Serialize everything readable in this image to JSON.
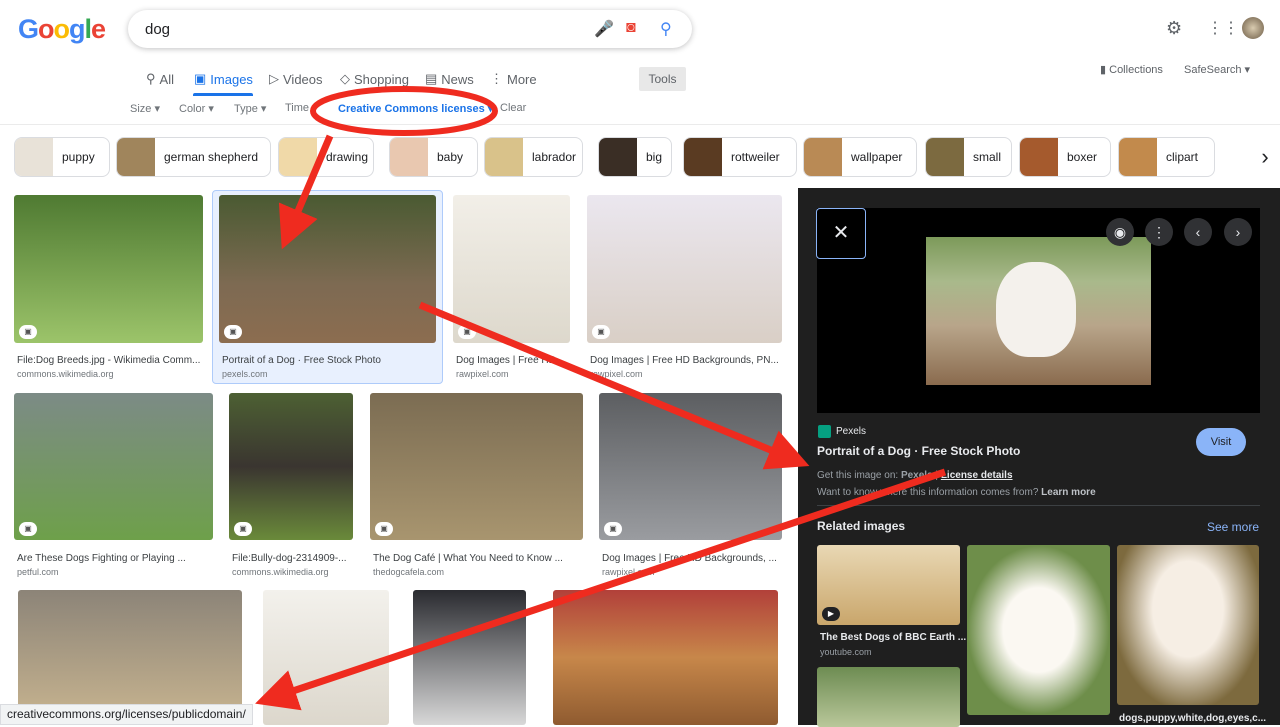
{
  "header": {
    "logo": "Google",
    "query": "dog",
    "settings_icon": "gear-icon",
    "apps_icon": "grid-icon"
  },
  "tabs": [
    {
      "label": "All",
      "icon": "search-icon"
    },
    {
      "label": "Images",
      "icon": "image-icon",
      "active": true
    },
    {
      "label": "Videos",
      "icon": "play-icon"
    },
    {
      "label": "Shopping",
      "icon": "tag-icon"
    },
    {
      "label": "News",
      "icon": "news-icon"
    },
    {
      "label": "More",
      "icon": "dots-icon"
    }
  ],
  "tools_label": "Tools",
  "filters": {
    "size": "Size",
    "color": "Color",
    "type": "Type",
    "time": "Time",
    "license": "Creative Commons licenses",
    "clear": "Clear"
  },
  "right_links": {
    "collections": "Collections",
    "safesearch": "SafeSearch"
  },
  "chips": [
    "puppy",
    "german shepherd",
    "drawing",
    "baby",
    "labrador",
    "big",
    "rottweiler",
    "wallpaper",
    "small",
    "boxer",
    "clipart"
  ],
  "results": [
    {
      "title": "File:Dog Breeds.jpg - Wikimedia Comm...",
      "source": "commons.wikimedia.org"
    },
    {
      "title": "Portrait of a Dog · Free Stock Photo",
      "source": "pexels.com"
    },
    {
      "title": "Dog Images | Free HD ...",
      "source": "rawpixel.com"
    },
    {
      "title": "Dog Images | Free HD Backgrounds, PN...",
      "source": "rawpixel.com"
    },
    {
      "title": "Are These Dogs Fighting or Playing ...",
      "source": "petful.com"
    },
    {
      "title": "File:Bully-dog-2314909-...",
      "source": "commons.wikimedia.org"
    },
    {
      "title": "The Dog Café | What You Need to Know ...",
      "source": "thedogcafela.com"
    },
    {
      "title": "Dog Images | Free HD Backgrounds, ...",
      "source": "rawpixel.com"
    }
  ],
  "panel": {
    "source": "Pexels",
    "title": "Portrait of a Dog · Free Stock Photo",
    "visit": "Visit",
    "get_prefix": "Get this image on:",
    "get_source": "Pexels",
    "sep": "|",
    "license": "License details",
    "want": "Want to know where this information comes from?",
    "learn": "Learn more",
    "related": "Related images",
    "see_more": "See more",
    "related_items": [
      {
        "title": "The Best Dogs of BBC Earth ...",
        "source": "youtube.com"
      },
      {
        "title": "dogs,puppy,white,dog,eyes,c..."
      }
    ]
  },
  "status_url": "creativecommons.org/licenses/publicdomain/",
  "annotation_color": "#ef2b1f"
}
